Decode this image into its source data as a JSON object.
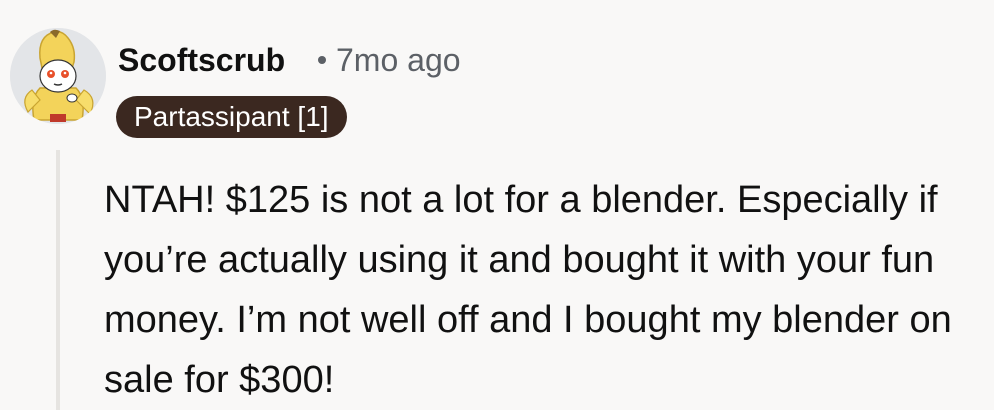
{
  "comment": {
    "author": "Scoftscrub",
    "timestamp": "7mo ago",
    "flair": "Partassipant [1]",
    "text": "NTAH! $125 is not a lot for a blender. Especially if you’re actually using it and bought it with your fun money. I’m not well off and I bought my blender on sale for $300!",
    "avatar_icon": "banana-costume-avatar-icon"
  },
  "colors": {
    "background": "#f9f8f7",
    "flair_background": "#3b2820",
    "flair_text": "#ffffff",
    "meta_text": "#5c6066",
    "thread_line": "#e6e4e1"
  }
}
